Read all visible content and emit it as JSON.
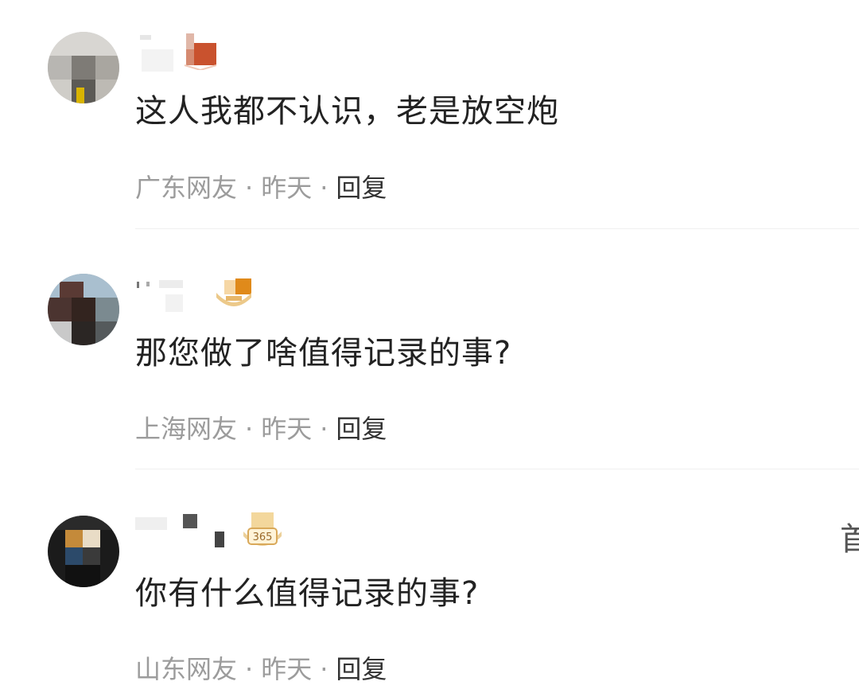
{
  "comments": [
    {
      "text": "这人我都不认识，老是放空炮",
      "location": "广东网友",
      "time": "昨天",
      "reply": "回复",
      "sep": "·"
    },
    {
      "text": "那您做了啥值得记录的事?",
      "location": "上海网友",
      "time": "昨天",
      "reply": "回复",
      "sep": "·"
    },
    {
      "text": "你有什么值得记录的事?",
      "location": "山东网友",
      "time": "昨天",
      "reply": "回复",
      "sep": "·",
      "badge_text": "365"
    }
  ],
  "edge_text": "首"
}
